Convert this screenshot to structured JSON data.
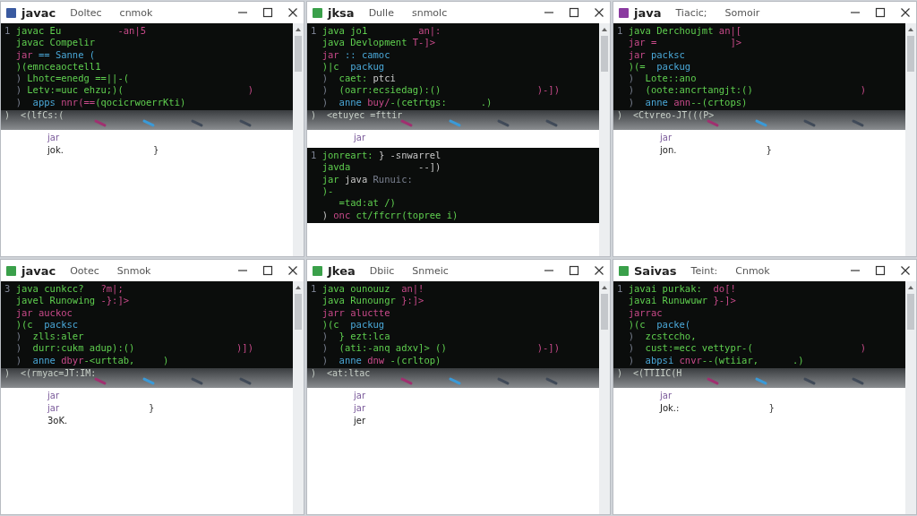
{
  "windows": [
    {
      "title": "javac",
      "icon": {
        "color": "#3a5aa0"
      },
      "menu": [
        "Doltec",
        "cnmok"
      ],
      "sections": [
        {
          "kind": "terminal",
          "lines": [
            {
              "segments": [
                {
                  "text": "1 ",
                  "kind": "comment"
                },
                {
                  "text": "javac Eu",
                  "kind": "keyword"
                },
                {
                  "text": "          -an|5",
                  "kind": "symbol"
                }
              ]
            },
            {
              "segments": [
                {
                  "text": "  javac Compelir",
                  "kind": "keyword"
                }
              ]
            },
            {
              "segments": [
                {
                  "text": "  jar",
                  "kind": "symbol"
                },
                {
                  "text": " == Sanne (",
                  "kind": "name"
                }
              ]
            },
            {
              "segments": [
                {
                  "text": "  )(emnceaoctell1",
                  "kind": "keyword"
                }
              ]
            },
            {
              "segments": [
                {
                  "text": "  ) ",
                  "kind": "comment"
                },
                {
                  "text": "Lhotc=enedg ==||-(",
                  "kind": "keyword"
                }
              ]
            },
            {
              "segments": [
                {
                  "text": "  ) ",
                  "kind": "comment"
                },
                {
                  "text": "Letv:=uuc ehzu;)(",
                  "kind": "keyword"
                }
              ],
              "tail": ")"
            },
            {
              "segments": [
                {
                  "text": "  )  ",
                  "kind": "comment"
                },
                {
                  "text": "apps ",
                  "kind": "name"
                },
                {
                  "text": "nnr(==",
                  "kind": "symbol"
                },
                {
                  "text": "(qocicrwoerrKti)",
                  "kind": "keyword"
                }
              ]
            }
          ]
        },
        {
          "kind": "strip",
          "text": ")  <(lfCs:(",
          "marks": [
            {
              "color": "#a03070"
            },
            {
              "color": "#3a9ad8"
            },
            {
              "color": "#404a58"
            },
            {
              "color": "#404a58"
            }
          ]
        },
        {
          "kind": "output",
          "lines": [
            {
              "text": "jar",
              "kind": "symbol"
            },
            {
              "text": "jok.",
              "kind": "plain",
              "tail": "}"
            }
          ]
        }
      ]
    },
    {
      "title": "jksa",
      "icon": {
        "color": "#3aa04a"
      },
      "menu": [
        "Dulle",
        "snmolc"
      ],
      "sections": [
        {
          "kind": "terminal",
          "lines": [
            {
              "segments": [
                {
                  "text": "1 ",
                  "kind": "comment"
                },
                {
                  "text": "java jo1",
                  "kind": "keyword"
                },
                {
                  "text": "         an|:",
                  "kind": "symbol"
                }
              ]
            },
            {
              "segments": [
                {
                  "text": "  java Devlopment",
                  "kind": "keyword"
                },
                {
                  "text": " T-]>",
                  "kind": "symbol"
                }
              ]
            },
            {
              "segments": [
                {
                  "text": "  jar",
                  "kind": "symbol"
                },
                {
                  "text": " :: camoc",
                  "kind": "name"
                }
              ]
            },
            {
              "segments": [
                {
                  "text": "  )|c  ",
                  "kind": "keyword"
                },
                {
                  "text": "packug",
                  "kind": "name"
                }
              ]
            },
            {
              "segments": [
                {
                  "text": "  )  ",
                  "kind": "comment"
                },
                {
                  "text": "caet:",
                  "kind": "keyword"
                },
                {
                  "text": " ptci",
                  "kind": "plain"
                }
              ]
            },
            {
              "segments": [
                {
                  "text": "  )  ",
                  "kind": "comment"
                },
                {
                  "text": "(oarr:ecsiedag):()",
                  "kind": "keyword"
                }
              ],
              "tail": ")-])"
            },
            {
              "segments": [
                {
                  "text": "  )  ",
                  "kind": "comment"
                },
                {
                  "text": "anne ",
                  "kind": "name"
                },
                {
                  "text": "buy/",
                  "kind": "symbol"
                },
                {
                  "text": "-(cetrtgs:      .)",
                  "kind": "keyword"
                }
              ]
            }
          ]
        },
        {
          "kind": "strip",
          "text": ")  <etuyec =fttir",
          "marks": [
            {
              "color": "#a03070"
            },
            {
              "color": "#3a9ad8"
            },
            {
              "color": "#404a58"
            },
            {
              "color": "#404a58"
            }
          ]
        },
        {
          "kind": "output",
          "lines": [
            {
              "text": "jar",
              "kind": "symbol"
            }
          ]
        },
        {
          "kind": "terminal",
          "lines": [
            {
              "segments": [
                {
                  "text": "1 ",
                  "kind": "comment"
                },
                {
                  "text": "jonreart:",
                  "kind": "keyword"
                },
                {
                  "text": " } -snwarrel",
                  "kind": "plain"
                }
              ]
            },
            {
              "segments": [
                {
                  "text": "  javda",
                  "kind": "keyword"
                },
                {
                  "text": "            --])",
                  "kind": "plain"
                }
              ]
            },
            {
              "segments": [
                {
                  "text": "  jar",
                  "kind": "keyword"
                },
                {
                  "text": " java",
                  "kind": "plain"
                },
                {
                  "text": " Runuic:",
                  "kind": "comment"
                }
              ]
            },
            {
              "segments": [
                {
                  "text": "  )-",
                  "kind": "keyword"
                }
              ]
            },
            {
              "segments": [
                {
                  "text": "     =tad:at /)",
                  "kind": "keyword"
                }
              ]
            },
            {
              "segments": [
                {
                  "text": "  ) ",
                  "kind": "plain"
                },
                {
                  "text": "onc ",
                  "kind": "symbol"
                },
                {
                  "text": "ct/ffcrr(topree i)",
                  "kind": "keyword"
                }
              ]
            }
          ]
        }
      ]
    },
    {
      "title": "java",
      "icon": {
        "color": "#8a3aa0"
      },
      "menu": [
        "Tiacic;",
        "Somoir"
      ],
      "sections": [
        {
          "kind": "terminal",
          "lines": [
            {
              "segments": [
                {
                  "text": "1 ",
                  "kind": "comment"
                },
                {
                  "text": "java Derchoujmt",
                  "kind": "keyword"
                },
                {
                  "text": " an|[",
                  "kind": "symbol"
                }
              ]
            },
            {
              "segments": [
                {
                  "text": "  jar =",
                  "kind": "symbol"
                },
                {
                  "text": "             ]>",
                  "kind": "symbol"
                }
              ]
            },
            {
              "segments": [
                {
                  "text": "  jar",
                  "kind": "symbol"
                },
                {
                  "text": " packsc",
                  "kind": "name"
                }
              ]
            },
            {
              "segments": [
                {
                  "text": "  )(=  ",
                  "kind": "keyword"
                },
                {
                  "text": "packug",
                  "kind": "name"
                }
              ]
            },
            {
              "segments": [
                {
                  "text": "  )  ",
                  "kind": "comment"
                },
                {
                  "text": "Lote::ano",
                  "kind": "keyword"
                }
              ]
            },
            {
              "segments": [
                {
                  "text": "  )  ",
                  "kind": "comment"
                },
                {
                  "text": "(oote:ancrtangjt:()",
                  "kind": "keyword"
                }
              ],
              "tail": ")"
            },
            {
              "segments": [
                {
                  "text": "  )  ",
                  "kind": "comment"
                },
                {
                  "text": "anne ",
                  "kind": "name"
                },
                {
                  "text": "ann",
                  "kind": "symbol"
                },
                {
                  "text": "--(crtops)",
                  "kind": "keyword"
                }
              ]
            }
          ]
        },
        {
          "kind": "strip",
          "text": ")  <Ctvreo-JT(((P>",
          "marks": [
            {
              "color": "#a03070"
            },
            {
              "color": "#3a9ad8"
            },
            {
              "color": "#404a58"
            },
            {
              "color": "#404a58"
            }
          ]
        },
        {
          "kind": "output",
          "lines": [
            {
              "text": "jar",
              "kind": "symbol"
            },
            {
              "text": "jon.",
              "kind": "plain",
              "tail": "}"
            }
          ]
        }
      ]
    },
    {
      "title": "javac",
      "icon": {
        "color": "#3aa04a"
      },
      "menu": [
        "Ootec",
        "Snmok"
      ],
      "sections": [
        {
          "kind": "terminal",
          "lines": [
            {
              "segments": [
                {
                  "text": "3 ",
                  "kind": "comment"
                },
                {
                  "text": "java cunkcc?",
                  "kind": "keyword"
                },
                {
                  "text": "   ?m|;",
                  "kind": "symbol"
                }
              ]
            },
            {
              "segments": [
                {
                  "text": "  javel Runowing",
                  "kind": "keyword"
                },
                {
                  "text": " -}:]>",
                  "kind": "symbol"
                }
              ]
            },
            {
              "segments": [
                {
                  "text": "  jar",
                  "kind": "symbol"
                },
                {
                  "text": " auckoc",
                  "kind": "symbol"
                }
              ]
            },
            {
              "segments": [
                {
                  "text": "  )(c  ",
                  "kind": "keyword"
                },
                {
                  "text": "packsc",
                  "kind": "name"
                }
              ]
            },
            {
              "segments": [
                {
                  "text": "  )  ",
                  "kind": "comment"
                },
                {
                  "text": "zlls:aler",
                  "kind": "keyword"
                }
              ]
            },
            {
              "segments": [
                {
                  "text": "  )  ",
                  "kind": "comment"
                },
                {
                  "text": "durr:cukm adup):()",
                  "kind": "keyword"
                }
              ],
              "tail": ")])"
            },
            {
              "segments": [
                {
                  "text": "  )  ",
                  "kind": "comment"
                },
                {
                  "text": "anne ",
                  "kind": "name"
                },
                {
                  "text": "dbyr",
                  "kind": "symbol"
                },
                {
                  "text": "-<urttab,     )",
                  "kind": "keyword"
                }
              ]
            }
          ]
        },
        {
          "kind": "strip",
          "text": ")  <(rmyac=JT:IM:",
          "marks": [
            {
              "color": "#a03070"
            },
            {
              "color": "#3a9ad8"
            },
            {
              "color": "#404a58"
            },
            {
              "color": "#404a58"
            }
          ]
        },
        {
          "kind": "output",
          "lines": [
            {
              "text": "jar",
              "kind": "symbol"
            },
            {
              "text": "jar",
              "kind": "symbol",
              "tail": "}"
            },
            {
              "text": "3oK.",
              "kind": "plain"
            }
          ]
        }
      ]
    },
    {
      "title": "Jkea",
      "icon": {
        "color": "#3aa04a"
      },
      "menu": [
        "Dbiic",
        "Snmeic"
      ],
      "sections": [
        {
          "kind": "terminal",
          "lines": [
            {
              "segments": [
                {
                  "text": "1 ",
                  "kind": "comment"
                },
                {
                  "text": "java ounouuz",
                  "kind": "keyword"
                },
                {
                  "text": "  an|!",
                  "kind": "symbol"
                }
              ]
            },
            {
              "segments": [
                {
                  "text": "  java Runoungr",
                  "kind": "keyword"
                },
                {
                  "text": " }:]>",
                  "kind": "symbol"
                }
              ]
            },
            {
              "segments": [
                {
                  "text": "  jarr",
                  "kind": "symbol"
                },
                {
                  "text": " aluctte",
                  "kind": "symbol"
                }
              ]
            },
            {
              "segments": [
                {
                  "text": "  )(c  ",
                  "kind": "keyword"
                },
                {
                  "text": "packug",
                  "kind": "name"
                }
              ]
            },
            {
              "segments": [
                {
                  "text": "  )  ",
                  "kind": "comment"
                },
                {
                  "text": "} ezt:lca",
                  "kind": "keyword"
                }
              ]
            },
            {
              "segments": [
                {
                  "text": "  )  ",
                  "kind": "comment"
                },
                {
                  "text": "(ati:-anq adxv]> ()",
                  "kind": "keyword"
                }
              ],
              "tail": ")-])"
            },
            {
              "segments": [
                {
                  "text": "  )  ",
                  "kind": "comment"
                },
                {
                  "text": "anne ",
                  "kind": "name"
                },
                {
                  "text": "dnw",
                  "kind": "symbol"
                },
                {
                  "text": " -(crltop)",
                  "kind": "keyword"
                }
              ]
            }
          ]
        },
        {
          "kind": "strip",
          "text": ")  <at:ltac",
          "marks": [
            {
              "color": "#a03070"
            },
            {
              "color": "#3a9ad8"
            },
            {
              "color": "#404a58"
            },
            {
              "color": "#404a58"
            }
          ]
        },
        {
          "kind": "output",
          "lines": [
            {
              "text": "jar",
              "kind": "symbol"
            },
            {
              "text": "jar",
              "kind": "symbol"
            },
            {
              "text": "jer",
              "kind": "plain"
            }
          ]
        }
      ]
    },
    {
      "title": "Saivas",
      "icon": {
        "color": "#3aa04a"
      },
      "menu": [
        "Teint:",
        "Cnmok"
      ],
      "sections": [
        {
          "kind": "terminal",
          "lines": [
            {
              "segments": [
                {
                  "text": "1 ",
                  "kind": "comment"
                },
                {
                  "text": "javai purkak:",
                  "kind": "keyword"
                },
                {
                  "text": "  do[!",
                  "kind": "symbol"
                }
              ]
            },
            {
              "segments": [
                {
                  "text": "  javai Runuwuwr",
                  "kind": "keyword"
                },
                {
                  "text": " }-]>",
                  "kind": "symbol"
                }
              ]
            },
            {
              "segments": [
                {
                  "text": "  jarrac",
                  "kind": "symbol"
                }
              ]
            },
            {
              "segments": [
                {
                  "text": "  )(c  ",
                  "kind": "keyword"
                },
                {
                  "text": "packe(",
                  "kind": "name"
                }
              ]
            },
            {
              "segments": [
                {
                  "text": "  )  ",
                  "kind": "comment"
                },
                {
                  "text": "zcstccho,",
                  "kind": "keyword"
                }
              ]
            },
            {
              "segments": [
                {
                  "text": "  )  ",
                  "kind": "comment"
                },
                {
                  "text": "cust:=ecc vettypr-(",
                  "kind": "keyword"
                }
              ],
              "tail": ")"
            },
            {
              "segments": [
                {
                  "text": "  )  ",
                  "kind": "comment"
                },
                {
                  "text": "abpsi ",
                  "kind": "name"
                },
                {
                  "text": "cnvr",
                  "kind": "symbol"
                },
                {
                  "text": "--(wtiiar,      .)",
                  "kind": "keyword"
                }
              ]
            }
          ]
        },
        {
          "kind": "strip",
          "text": ")  <(TTIIC(H",
          "marks": [
            {
              "color": "#a03070"
            },
            {
              "color": "#3a9ad8"
            },
            {
              "color": "#404a58"
            },
            {
              "color": "#404a58"
            }
          ]
        },
        {
          "kind": "output",
          "lines": [
            {
              "text": "jar",
              "kind": "symbol"
            },
            {
              "text": "Jok.:",
              "kind": "plain",
              "tail": "}"
            }
          ]
        }
      ]
    }
  ]
}
